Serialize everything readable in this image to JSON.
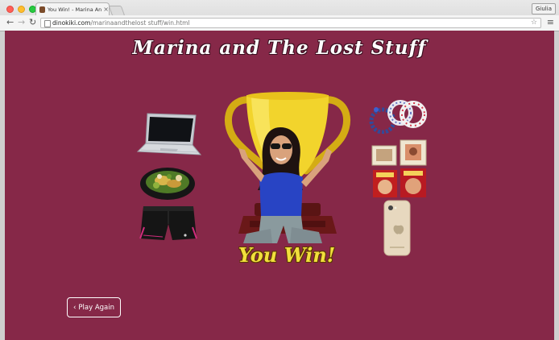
{
  "browser": {
    "tab_title": "You Win! - Marina And",
    "tab_close": "×",
    "user": "Giulia",
    "url_domain": "dinokiki.com",
    "url_path": "/marinaandthelost stuff/win.html",
    "colors": {
      "close": "#ff5f57",
      "minimize": "#ffbd2e",
      "maximize": "#28c940"
    }
  },
  "page": {
    "title": "Marina and The Lost Stuff",
    "win_text": "You Win!",
    "play_again": "Play Again",
    "background": "#862848"
  },
  "items": {
    "left": [
      "laptop",
      "salad-bowl",
      "running-shorts"
    ],
    "right": [
      "bracelets",
      "framed-pictures",
      "picture-books",
      "phone"
    ],
    "center": [
      "trophy",
      "winner-photo"
    ]
  }
}
